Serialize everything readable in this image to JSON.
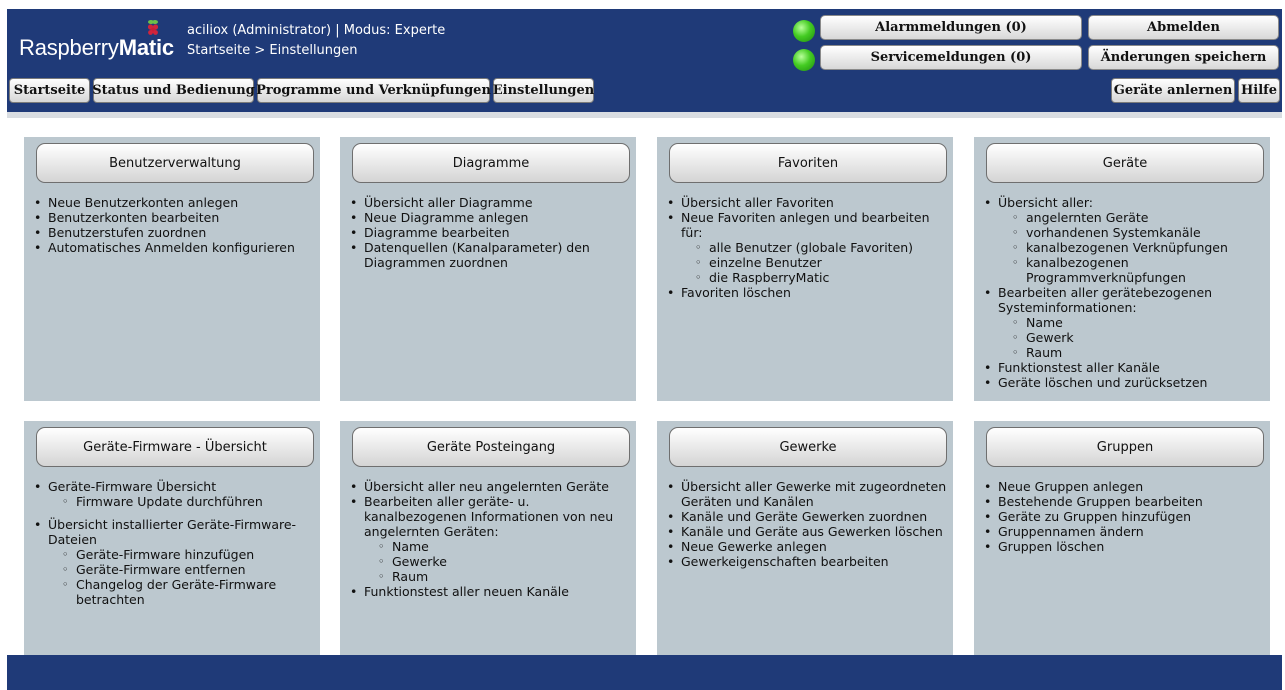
{
  "header": {
    "logo_light": "Raspberry",
    "logo_bold": "Matic",
    "user_line": "aciliox (Administrator) | Modus: Experte",
    "breadcrumb": "Startseite > Einstellungen",
    "alarm_label": "Alarmmeldungen (0)",
    "service_label": "Servicemeldungen (0)",
    "logout_label": "Abmelden",
    "save_label": "Änderungen speichern",
    "lamp_color": "#44cc22"
  },
  "nav": {
    "home": "Startseite",
    "status": "Status und Bedienung",
    "programs": "Programme und Verknüpfungen",
    "settings": "Einstellungen",
    "teach": "Geräte anlernen",
    "help": "Hilfe"
  },
  "cards": [
    {
      "title": "Benutzerverwaltung",
      "items": [
        {
          "text": "Neue Benutzerkonten anlegen"
        },
        {
          "text": "Benutzerkonten bearbeiten"
        },
        {
          "text": "Benutzerstufen zuordnen"
        },
        {
          "text": "Automatisches Anmelden konfigurieren"
        }
      ]
    },
    {
      "title": "Diagramme",
      "items": [
        {
          "text": "Übersicht aller Diagramme"
        },
        {
          "text": "Neue Diagramme anlegen"
        },
        {
          "text": "Diagramme bearbeiten"
        },
        {
          "text": "Datenquellen (Kanalparameter) den Diagrammen zuordnen"
        }
      ]
    },
    {
      "title": "Favoriten",
      "items": [
        {
          "text": "Übersicht aller Favoriten"
        },
        {
          "text": "Neue Favoriten anlegen und bearbeiten für:",
          "sub": [
            "alle Benutzer (globale Favoriten)",
            "einzelne Benutzer",
            "die RaspberryMatic"
          ]
        },
        {
          "text": "Favoriten löschen"
        }
      ]
    },
    {
      "title": "Geräte",
      "items": [
        {
          "text": "Übersicht aller:",
          "sub": [
            "angelernten Geräte",
            "vorhandenen Systemkanäle",
            "kanalbezogenen Verknüpfungen",
            "kanalbezogenen Programmverknüpfungen"
          ]
        },
        {
          "text": "Bearbeiten aller gerätebezogenen Systeminformationen:",
          "sub": [
            "Name",
            "Gewerk",
            "Raum"
          ]
        },
        {
          "text": "Funktionstest aller Kanäle"
        },
        {
          "text": "Geräte löschen und zurücksetzen"
        }
      ]
    },
    {
      "title": "Geräte-Firmware - Übersicht",
      "items": [
        {
          "text": "Geräte-Firmware Übersicht",
          "sub": [
            "Firmware Update durchführen"
          ]
        },
        {
          "text": "Übersicht installierter Geräte-Firmware-Dateien",
          "gap": true,
          "sub": [
            "Geräte-Firmware hinzufügen",
            "Geräte-Firmware entfernen",
            "Changelog der Geräte-Firmware betrachten"
          ]
        }
      ]
    },
    {
      "title": "Geräte Posteingang",
      "items": [
        {
          "text": "Übersicht aller neu angelernten Geräte"
        },
        {
          "text": "Bearbeiten aller geräte- u. kanalbezogenen Informationen von neu angelernten Geräten:",
          "sub": [
            "Name",
            "Gewerke",
            "Raum"
          ]
        },
        {
          "text": "Funktionstest aller neuen Kanäle"
        }
      ]
    },
    {
      "title": "Gewerke",
      "items": [
        {
          "text": "Übersicht aller Gewerke mit zugeordneten Geräten und Kanälen"
        },
        {
          "text": "Kanäle und Geräte Gewerken zuordnen"
        },
        {
          "text": "Kanäle und Geräte aus Gewerken löschen"
        },
        {
          "text": "Neue Gewerke anlegen"
        },
        {
          "text": "Gewerkeigenschaften bearbeiten"
        }
      ]
    },
    {
      "title": "Gruppen",
      "items": [
        {
          "text": "Neue Gruppen anlegen"
        },
        {
          "text": "Bestehende Gruppen bearbeiten"
        },
        {
          "text": "Geräte zu Gruppen hinzufügen"
        },
        {
          "text": "Gruppennamen ändern"
        },
        {
          "text": "Gruppen löschen"
        }
      ]
    }
  ]
}
